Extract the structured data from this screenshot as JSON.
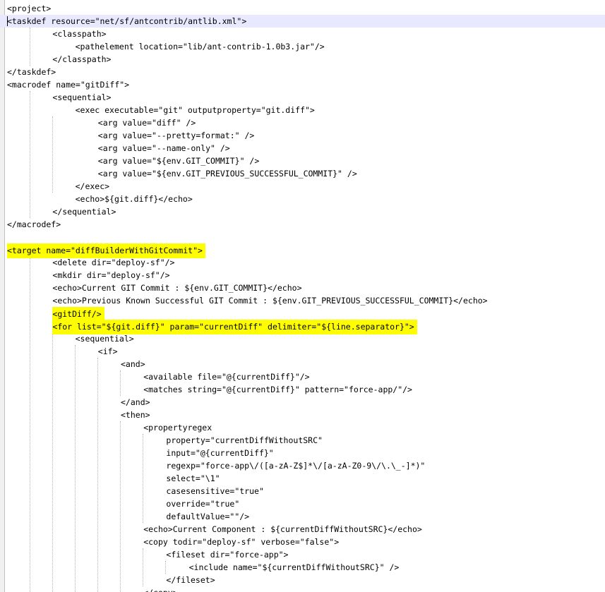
{
  "editor": {
    "current_line": 1,
    "highlighted_lines": [
      19,
      24,
      25
    ],
    "highlight_color": "#fefe00",
    "current_line_color": "#e8e8ff",
    "lines": [
      {
        "indent": 0,
        "text": "<project>"
      },
      {
        "indent": 0,
        "text": "<taskdef resource=\"net/sf/antcontrib/antlib.xml\">"
      },
      {
        "indent": 2,
        "text": "<classpath>"
      },
      {
        "indent": 3,
        "text": "<pathelement location=\"lib/ant-contrib-1.0b3.jar\"/>"
      },
      {
        "indent": 2,
        "text": "</classpath>"
      },
      {
        "indent": 0,
        "text": "</taskdef>"
      },
      {
        "indent": 0,
        "text": "<macrodef name=\"gitDiff\">"
      },
      {
        "indent": 2,
        "text": "<sequential>"
      },
      {
        "indent": 3,
        "text": "<exec executable=\"git\" outputproperty=\"git.diff\">"
      },
      {
        "indent": 4,
        "text": "<arg value=\"diff\" />"
      },
      {
        "indent": 4,
        "text": "<arg value=\"--pretty=format:\" />"
      },
      {
        "indent": 4,
        "text": "<arg value=\"--name-only\" />"
      },
      {
        "indent": 4,
        "text": "<arg value=\"${env.GIT_COMMIT}\" />"
      },
      {
        "indent": 4,
        "text": "<arg value=\"${env.GIT_PREVIOUS_SUCCESSFUL_COMMIT}\" />"
      },
      {
        "indent": 3,
        "text": "</exec>"
      },
      {
        "indent": 3,
        "text": "<echo>${git.diff}</echo>"
      },
      {
        "indent": 2,
        "text": "</sequential>"
      },
      {
        "indent": 0,
        "text": "</macrodef>"
      },
      {
        "indent": 0,
        "text": ""
      },
      {
        "indent": 0,
        "text": "<target name=\"diffBuilderWithGitCommit\">"
      },
      {
        "indent": 2,
        "text": "<delete dir=\"deploy-sf\"/>"
      },
      {
        "indent": 2,
        "text": "<mkdir dir=\"deploy-sf\"/>"
      },
      {
        "indent": 2,
        "text": "<echo>Current GIT Commit : ${env.GIT_COMMIT}</echo>"
      },
      {
        "indent": 2,
        "text": "<echo>Previous Known Successful GIT Commit : ${env.GIT_PREVIOUS_SUCCESSFUL_COMMIT}</echo>"
      },
      {
        "indent": 2,
        "text": "<gitDiff/>"
      },
      {
        "indent": 2,
        "text": "<for list=\"${git.diff}\" param=\"currentDiff\" delimiter=\"${line.separator}\">"
      },
      {
        "indent": 3,
        "text": "<sequential>"
      },
      {
        "indent": 4,
        "text": "<if>"
      },
      {
        "indent": 5,
        "text": "<and>"
      },
      {
        "indent": 6,
        "text": "<available file=\"@{currentDiff}\"/>"
      },
      {
        "indent": 6,
        "text": "<matches string=\"@{currentDiff}\" pattern=\"force-app/\"/>"
      },
      {
        "indent": 5,
        "text": "</and>"
      },
      {
        "indent": 5,
        "text": "<then>"
      },
      {
        "indent": 6,
        "text": "<propertyregex"
      },
      {
        "indent": 7,
        "text": "property=\"currentDiffWithoutSRC\""
      },
      {
        "indent": 7,
        "text": "input=\"@{currentDiff}\""
      },
      {
        "indent": 7,
        "text": "regexp=\"force-app\\/([a-zA-Z$]*\\/[a-zA-Z0-9\\/\\.\\_-]*)\""
      },
      {
        "indent": 7,
        "text": "select=\"\\1\""
      },
      {
        "indent": 7,
        "text": "casesensitive=\"true\""
      },
      {
        "indent": 7,
        "text": "override=\"true\""
      },
      {
        "indent": 7,
        "text": "defaultValue=\"\"/>"
      },
      {
        "indent": 6,
        "text": "<echo>Current Component : ${currentDiffWithoutSRC}</echo>"
      },
      {
        "indent": 6,
        "text": "<copy todir=\"deploy-sf\" verbose=\"false\">"
      },
      {
        "indent": 7,
        "text": "<fileset dir=\"force-app\">"
      },
      {
        "indent": 8,
        "text": "<include name=\"${currentDiffWithoutSRC}\" />"
      },
      {
        "indent": 7,
        "text": "</fileset>"
      },
      {
        "indent": 6,
        "text": "</copy>"
      }
    ]
  }
}
